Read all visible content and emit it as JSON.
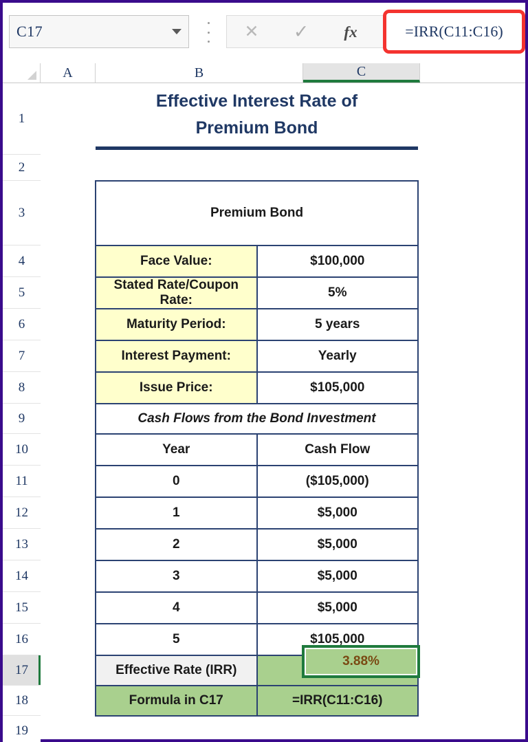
{
  "formula_bar": {
    "name_box_value": "C17",
    "name_box_caret_icon": "chevron-down-icon",
    "cancel_icon": "✕",
    "enter_icon": "✓",
    "fx_icon": "fx",
    "formula_value": "=IRR(C11:C16)",
    "highlight_color": "#f4332f"
  },
  "grid": {
    "columns": [
      "A",
      "B",
      "C"
    ],
    "active_column": "C",
    "rows": [
      "1",
      "2",
      "3",
      "4",
      "5",
      "6",
      "7",
      "8",
      "9",
      "10",
      "11",
      "12",
      "13",
      "14",
      "15",
      "16",
      "17",
      "18",
      "19"
    ],
    "active_row": "17",
    "accent_color": "#1f7a3d"
  },
  "sheet": {
    "title_line1": "Effective Interest Rate of",
    "title_line2": "Premium Bond",
    "title_color": "#1f3864",
    "table_header": "Premium Bond",
    "params": [
      {
        "label": "Face Value:",
        "value": "$100,000"
      },
      {
        "label": "Stated Rate/Coupon Rate:",
        "value": "5%"
      },
      {
        "label": "Maturity Period:",
        "value": "5 years"
      },
      {
        "label": "Interest Payment:",
        "value": "Yearly"
      },
      {
        "label": "Issue Price:",
        "value": "$105,000"
      }
    ],
    "cashflow_section_title": "Cash Flows from the Bond Investment",
    "cashflow_headers": {
      "year": "Year",
      "cash_flow": "Cash Flow"
    },
    "cashflows": [
      {
        "year": "0",
        "amount": "($105,000)"
      },
      {
        "year": "1",
        "amount": "$5,000"
      },
      {
        "year": "2",
        "amount": "$5,000"
      },
      {
        "year": "3",
        "amount": "$5,000"
      },
      {
        "year": "4",
        "amount": "$5,000"
      },
      {
        "year": "5",
        "amount": "$105,000"
      }
    ],
    "result_label": "Effective Rate (IRR)",
    "result_value": "3.88%",
    "formula_label": "Formula in C17",
    "formula_text": "=IRR(C11:C16)",
    "colors": {
      "label_fill": "#ffffcc",
      "green_fill": "#a9d08e",
      "gray_fill": "#f1f1f1",
      "negative_text": "#ff0000",
      "border": "#2b4272"
    }
  }
}
